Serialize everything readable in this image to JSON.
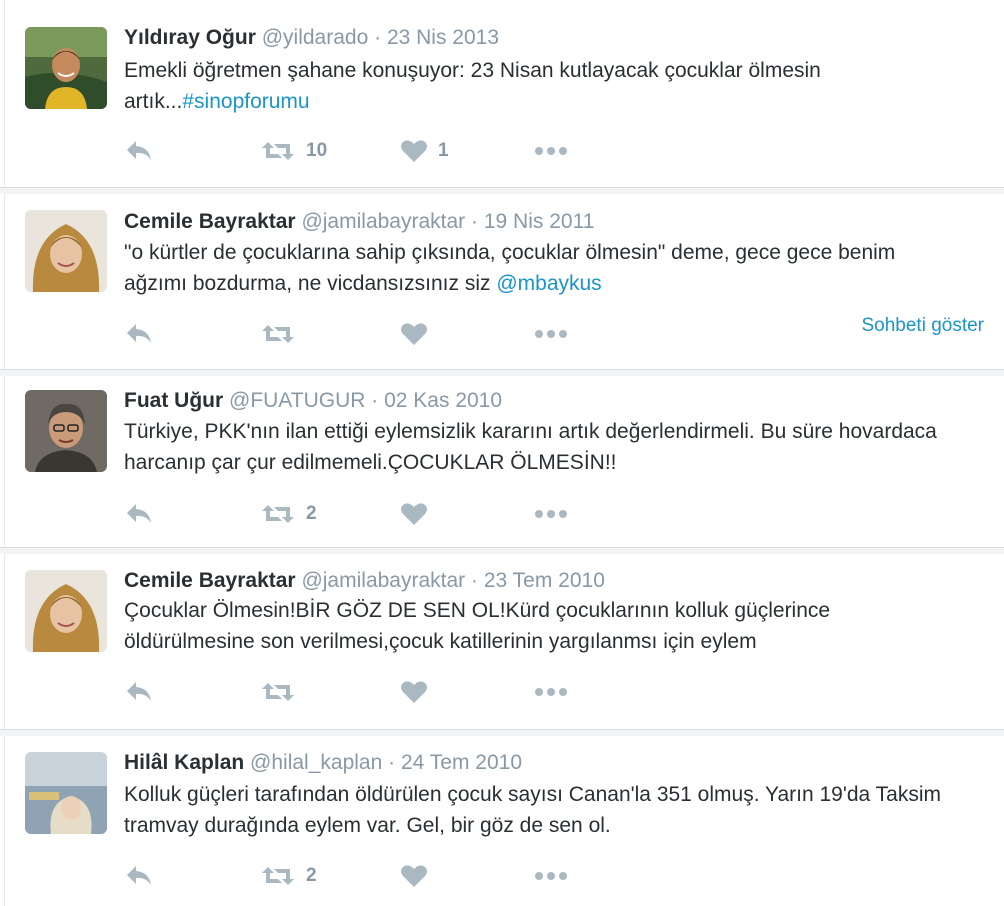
{
  "tweets": [
    {
      "name": "Yıldıray Oğur",
      "handle": "@yildarado",
      "dot": "·",
      "date": "23 Nis 2013",
      "text_plain": "Emekli öğretmen şahane konuşuyor: 23 Nisan kutlayacak çocuklar ölmesin artık...",
      "hashtag": "#sinopforumu",
      "retweets": "10",
      "likes": "1"
    },
    {
      "name": "Cemile Bayraktar",
      "handle": "@jamilabayraktar",
      "dot": "·",
      "date": "19 Nis 2011",
      "text_plain": "\"o kürtler de çocuklarına sahip çıksında, çocuklar ölmesin\" deme, gece gece benim ağzımı bozdurma, ne vicdansızsınız siz ",
      "mention": "@mbaykus",
      "retweets": "",
      "likes": "",
      "conversation_link": "Sohbeti göster"
    },
    {
      "name": "Fuat Uğur",
      "handle": "@FUATUGUR",
      "dot": "·",
      "date": "02 Kas 2010",
      "text_plain": "Türkiye, PKK'nın ilan ettiği eylemsizlik kararını artık değerlendirmeli. Bu süre hovardaca harcanıp çar çur edilmemeli.ÇOCUKLAR ÖLMESİN!!",
      "retweets": "2",
      "likes": ""
    },
    {
      "name": "Cemile Bayraktar",
      "handle": "@jamilabayraktar",
      "dot": "·",
      "date": "23 Tem 2010",
      "text_plain": "Çocuklar Ölmesin!BİR GÖZ DE SEN OL!Kürd çocuklarının kolluk güçlerince öldürülmesine son verilmesi,çocuk katillerinin yargılanmsı için eylem",
      "retweets": "",
      "likes": ""
    },
    {
      "name": "Hilâl Kaplan",
      "handle": "@hilal_kaplan",
      "dot": "·",
      "date": "24 Tem 2010",
      "text_plain": "Kolluk güçleri tarafından öldürülen çocuk sayısı Canan'la 351 olmuş. Yarın 19'da Taksim tramvay durağında eylem var. Gel, bir göz de sen ol.",
      "retweets": "2",
      "likes": ""
    }
  ],
  "icons": {
    "reply": "reply-icon",
    "retweet": "retweet-icon",
    "like": "heart-icon",
    "more": "more-icon"
  },
  "colors": {
    "icon_gray": "#aab8c2",
    "link_blue": "#1b95c9",
    "meta_gray": "#8899a6"
  }
}
